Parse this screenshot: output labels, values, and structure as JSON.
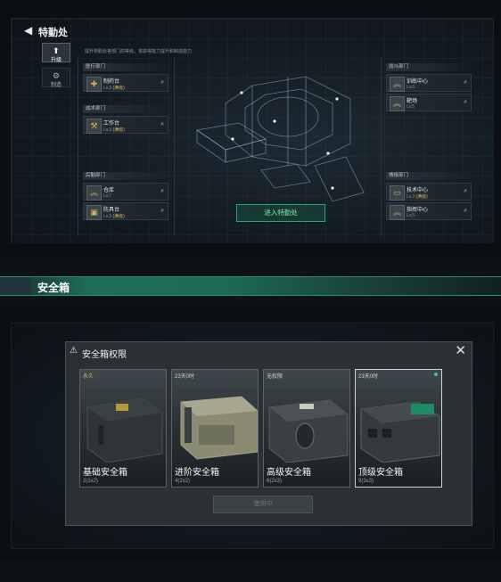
{
  "special_service": {
    "title": "特勤处",
    "hint": "提升特勤处各部门的等级，将获得能力提升和制造能力",
    "tabs": [
      {
        "label": "升级",
        "icon": "upgrade-icon"
      },
      {
        "label": "制造",
        "icon": "craft-icon"
      }
    ],
    "departments": {
      "medical": {
        "label": "医疗部门",
        "facilities": [
          {
            "name": "制药台",
            "level": "Lv.3",
            "tag": "(满级)"
          }
        ]
      },
      "tactical": {
        "label": "战术部门",
        "facilities": [
          {
            "name": "工作台",
            "level": "Lv.3",
            "tag": "(满级)"
          }
        ]
      },
      "logistics": {
        "label": "后勤部门",
        "facilities": [
          {
            "name": "仓库",
            "level": "Lv.7",
            "tag": ""
          },
          {
            "name": "防具台",
            "level": "Lv.3",
            "tag": "(满级)"
          }
        ]
      },
      "combat": {
        "label": "战斗部门",
        "facilities": [
          {
            "name": "训练中心",
            "level": "Lv.6",
            "tag": ""
          },
          {
            "name": "靶场",
            "level": "Lv.5",
            "tag": ""
          }
        ]
      },
      "intel": {
        "label": "情报部门",
        "facilities": [
          {
            "name": "技术中心",
            "level": "Lv.3",
            "tag": "(满级)"
          },
          {
            "name": "指挥中心",
            "level": "Lv.5",
            "tag": ""
          }
        ]
      }
    },
    "enter_button": "进入特勤处"
  },
  "banner": {
    "title": "安全箱"
  },
  "safe_box": {
    "title": "安全箱权限",
    "cards": [
      {
        "duration": "永久",
        "name": "基础安全箱",
        "size": "2(1x2)",
        "selected": false
      },
      {
        "duration": "23天0时",
        "name": "进阶安全箱",
        "size": "4(2x2)",
        "selected": false
      },
      {
        "duration": "无权限",
        "name": "高级安全箱",
        "size": "6(2x3)",
        "selected": false
      },
      {
        "duration": "23天0时",
        "name": "顶级安全箱",
        "size": "9(3x3)",
        "selected": true
      }
    ],
    "use_button": "使用中"
  },
  "colors": {
    "accent_green": "#2aa37a",
    "gold": "#d8b25a",
    "banner_green": "#1d6e55"
  }
}
